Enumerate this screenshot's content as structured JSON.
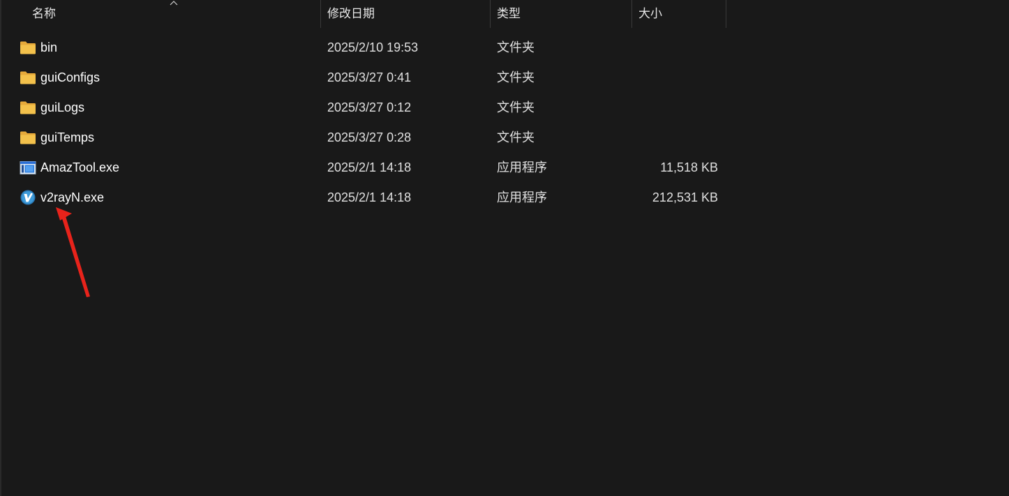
{
  "columns": {
    "name": "名称",
    "date": "修改日期",
    "type": "类型",
    "size": "大小"
  },
  "files": [
    {
      "name": "bin",
      "date": "2025/2/10 19:53",
      "type": "文件夹",
      "size": "",
      "icon": "folder-icon"
    },
    {
      "name": "guiConfigs",
      "date": "2025/3/27 0:41",
      "type": "文件夹",
      "size": "",
      "icon": "folder-icon"
    },
    {
      "name": "guiLogs",
      "date": "2025/3/27 0:12",
      "type": "文件夹",
      "size": "",
      "icon": "folder-icon"
    },
    {
      "name": "guiTemps",
      "date": "2025/3/27 0:28",
      "type": "文件夹",
      "size": "",
      "icon": "folder-icon"
    },
    {
      "name": "AmazTool.exe",
      "date": "2025/2/1 14:18",
      "type": "应用程序",
      "size": "11,518 KB",
      "icon": "application-window-icon"
    },
    {
      "name": "v2rayN.exe",
      "date": "2025/2/1 14:18",
      "type": "应用程序",
      "size": "212,531 KB",
      "icon": "v2rayn-logo-icon"
    }
  ],
  "colors": {
    "background": "#191919",
    "folder": "#f3c14b",
    "arrow": "#e8231b"
  }
}
